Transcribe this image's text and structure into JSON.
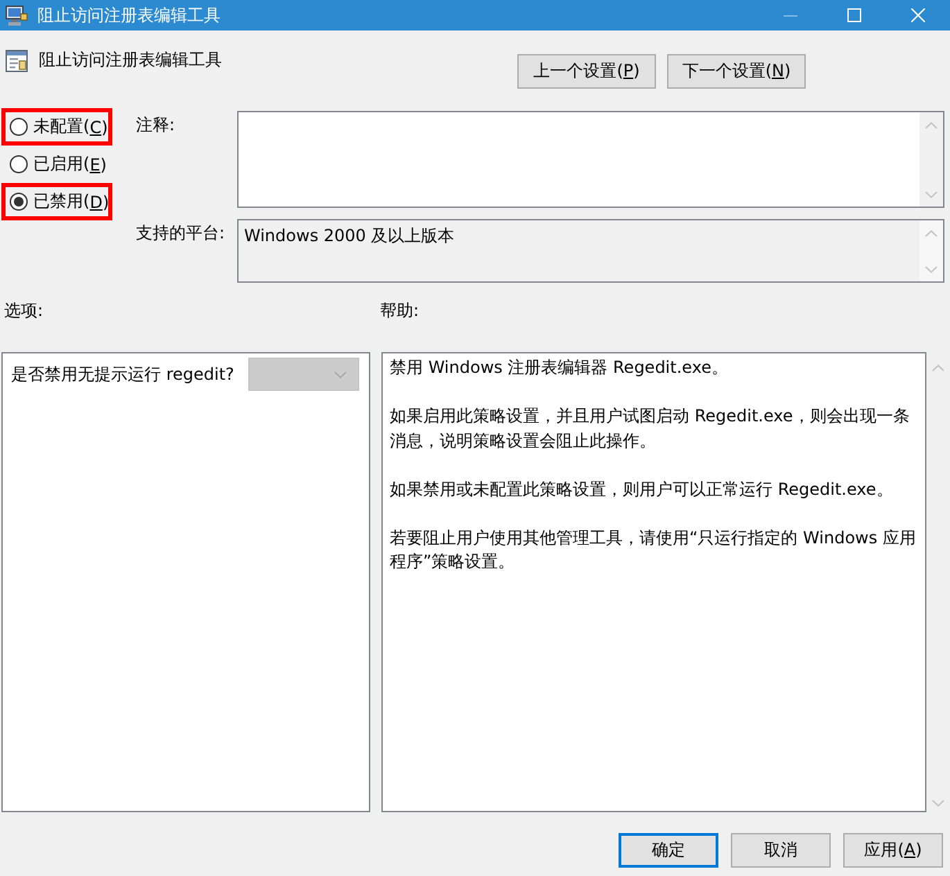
{
  "window": {
    "title": "阻止访问注册表编辑工具",
    "controls": [
      {
        "kind": "minimize",
        "disabled": true
      },
      {
        "kind": "maximize",
        "disabled": false
      },
      {
        "kind": "close",
        "disabled": false
      }
    ]
  },
  "header": {
    "title": "阻止访问注册表编辑工具",
    "buttons": [
      {
        "label": "上一个设置(",
        "access_key": "P",
        "label_end": ")"
      },
      {
        "label": "下一个设置(",
        "access_key": "N",
        "label_end": ")"
      }
    ]
  },
  "state_options": [
    {
      "label": "未配置(",
      "access_key": "C",
      "label_end": ")",
      "selected": false,
      "highlighted": true
    },
    {
      "label": "已启用(",
      "access_key": "E",
      "label_end": ")",
      "selected": false,
      "highlighted": false
    },
    {
      "label": "已禁用(",
      "access_key": "D",
      "label_end": ")",
      "selected": true,
      "highlighted": true
    }
  ],
  "comment": {
    "label": "注释:"
  },
  "supported_on": {
    "label": "支持的平台:",
    "value": "Windows 2000 及以上版本"
  },
  "options": {
    "label": "选项:",
    "items": [
      {
        "kind": "dropdown",
        "label": "是否禁用无提示运行 regedit?",
        "disabled": true
      }
    ]
  },
  "help": {
    "label": "帮助:",
    "paragraphs": [
      "禁用 Windows 注册表编辑器 Regedit.exe。",
      "如果启用此策略设置，并且用户试图启动 Regedit.exe，则会出现一条消息，说明策略设置会阻止此操作。",
      "如果禁用或未配置此策略设置，则用户可以正常运行 Regedit.exe。",
      "若要阻止用户使用其他管理工具，请使用“只运行指定的 Windows 应用程序”策略设置。"
    ]
  },
  "buttons": [
    {
      "label": "确定",
      "default": true
    },
    {
      "label": "取消",
      "default": false
    },
    {
      "label": "应用(",
      "access_key": "A",
      "label_end": ")",
      "default": false
    }
  ]
}
